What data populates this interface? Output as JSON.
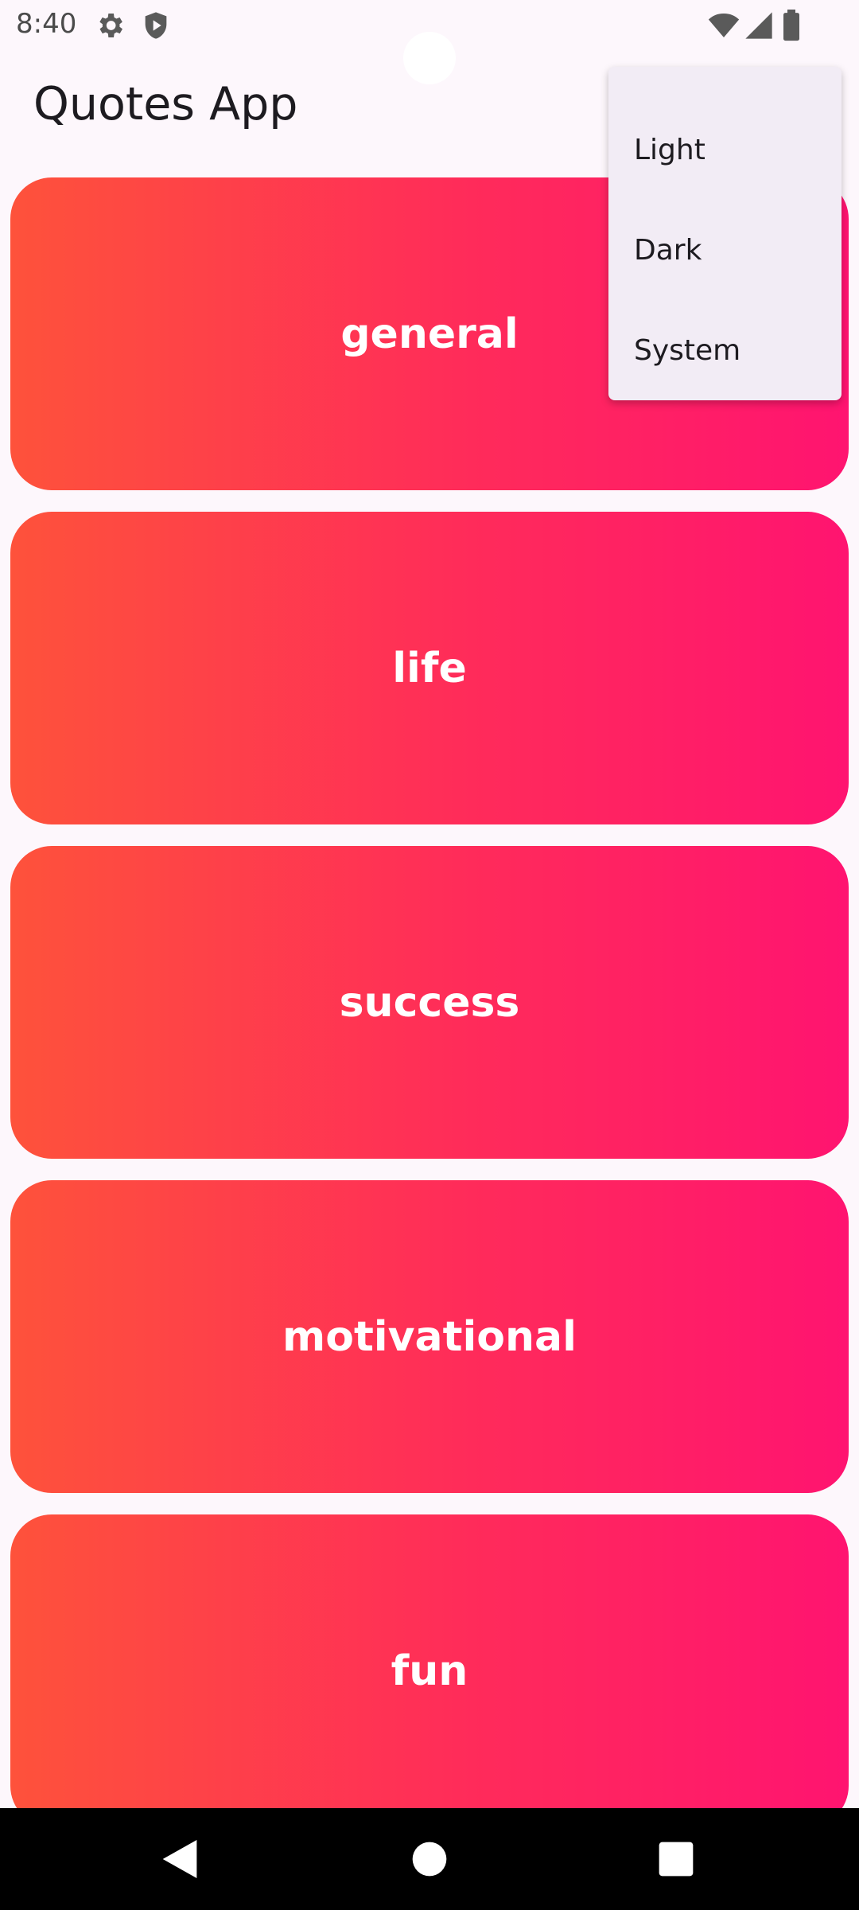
{
  "status_bar": {
    "time": "8:40",
    "icons_left": [
      "gear-icon",
      "shield-icon"
    ],
    "icons_right": [
      "wifi-icon",
      "signal-icon",
      "battery-icon"
    ]
  },
  "app_bar": {
    "title": "Quotes App"
  },
  "categories": [
    {
      "label": "general"
    },
    {
      "label": "life"
    },
    {
      "label": "success"
    },
    {
      "label": "motivational"
    },
    {
      "label": "fun"
    }
  ],
  "theme_menu": {
    "items": [
      {
        "label": "Light"
      },
      {
        "label": "Dark"
      },
      {
        "label": "System"
      }
    ]
  },
  "nav_bar": {
    "buttons": [
      "back-icon",
      "home-icon",
      "recents-icon"
    ]
  },
  "colors": {
    "background": "#fdf7fc",
    "card_gradient_start": "#fe523b",
    "card_gradient_end": "#ff1470",
    "menu_background": "#f2ecf5",
    "nav_background": "#000000"
  }
}
